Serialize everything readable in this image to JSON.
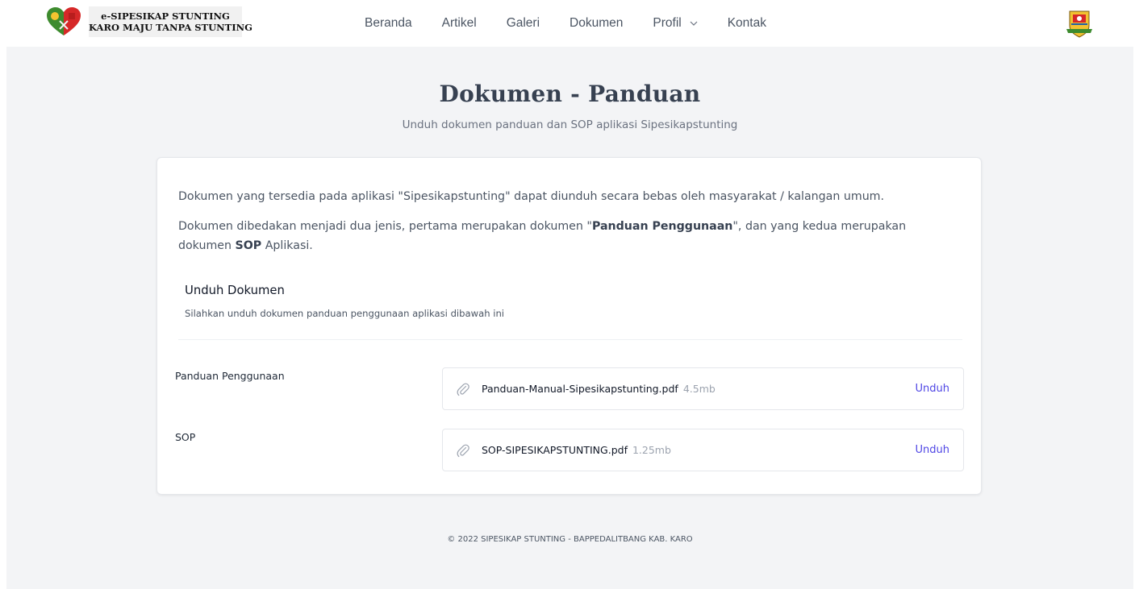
{
  "logo": {
    "line1": "e-SIPESIKAP STUNTING",
    "line2": "KARO MAJU TANPA STUNTING"
  },
  "nav": {
    "items": [
      "Beranda",
      "Artikel",
      "Galeri",
      "Dokumen",
      "Profil",
      "Kontak"
    ]
  },
  "page": {
    "title": "Dokumen - Panduan",
    "subtitle": "Unduh dokumen panduan dan SOP aplikasi Sipesikapstunting"
  },
  "card": {
    "intro1": "Dokumen yang tersedia pada aplikasi \"Sipesikapstunting\" dapat diunduh secara bebas oleh masyarakat / kalangan umum.",
    "intro2_pre": "Dokumen dibedakan menjadi dua jenis, pertama merupakan dokumen \"",
    "intro2_bold1": "Panduan Penggunaan",
    "intro2_mid": "\", dan yang kedua merupakan dokumen ",
    "intro2_bold2": "SOP",
    "intro2_post": " Aplikasi.",
    "section_title": "Unduh Dokumen",
    "section_desc": "Silahkan unduh dokumen panduan penggunaan aplikasi dibawah ini",
    "rows": [
      {
        "label": "Panduan Penggunaan",
        "file_name": "Panduan-Manual-Sipesikapstunting.pdf",
        "file_size": "4.5mb",
        "action": "Unduh"
      },
      {
        "label": "SOP",
        "file_name": "SOP-SIPESIKAPSTUNTING.pdf",
        "file_size": "1.25mb",
        "action": "Unduh"
      }
    ]
  },
  "footer": {
    "text": "© 2022 SIPESIKAP STUNTING - BAPPEDALITBANG KAB. KARO"
  },
  "colors": {
    "accent": "#4f46e5",
    "background": "#f3f4f6",
    "card": "#ffffff"
  },
  "icons": {
    "logo": "heart-logo-icon",
    "dropdown": "chevron-down-icon",
    "attachment": "paperclip-icon",
    "emblem": "regency-emblem-icon"
  }
}
